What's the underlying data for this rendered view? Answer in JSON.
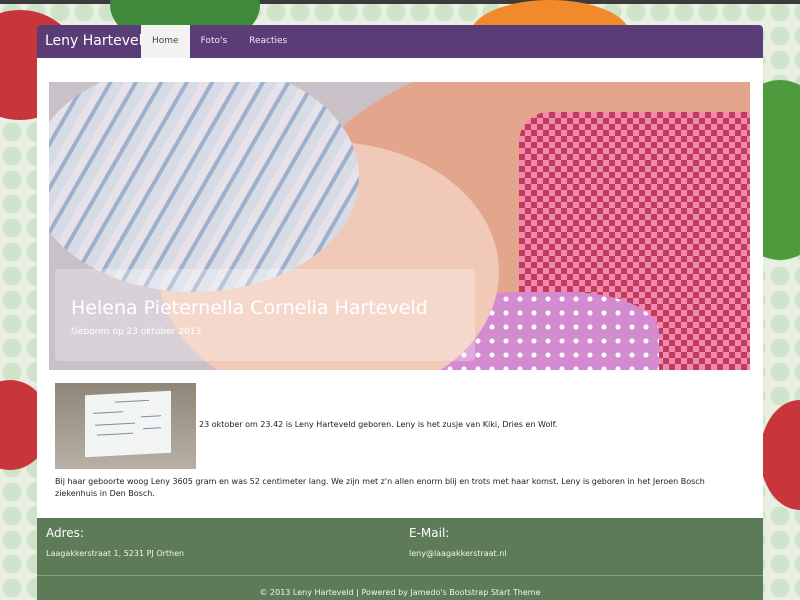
{
  "navbar": {
    "brand": "Leny Harteveld",
    "items": [
      {
        "label": "Home",
        "active": true
      },
      {
        "label": "Foto's",
        "active": false
      },
      {
        "label": "Reacties",
        "active": false
      }
    ]
  },
  "hero": {
    "title": "Helena Pieternella Cornelia Harteveld",
    "subtitle": "Geboren op 23 oktober 2013"
  },
  "content": {
    "intro": "23 oktober om 23.42 is Leny Harteveld geboren. Leny is het zusje van Kiki, Dries en Wolf.",
    "paragraph": "Bij haar geboorte woog Leny 3605 gram en was 52 centimeter lang. We zijn met z'n allen enorm blij en trots met haar komst. Leny is geboren in het Jeroen Bosch ziekenhuis in Den Bosch."
  },
  "footer": {
    "address_heading": "Adres:",
    "address": "Laagakkerstraat 1, 5231 PJ Orthen",
    "email_heading": "E-Mail:",
    "email": "leny@laagakkerstraat.nl",
    "copyright": "© 2013 Leny Harteveld | Powered by Jamedo's Bootstrap Start Theme"
  },
  "colors": {
    "navbar": "#5a3d77",
    "footer": "#5d7b56"
  }
}
